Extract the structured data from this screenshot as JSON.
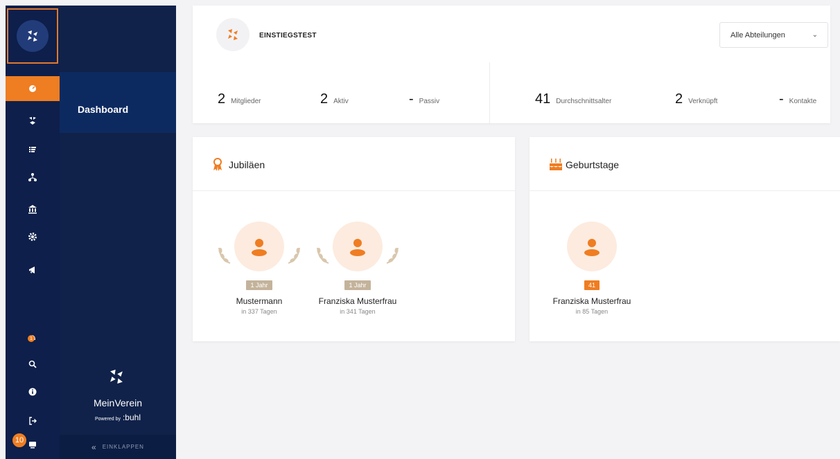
{
  "sidebar": {
    "menu_label": "Dashboard",
    "brand_name": "MeinVerein",
    "powered_by": "Powered by",
    "powered_brand": ":buhl",
    "collapse_label": "EINKLAPPEN",
    "notification_count": "1",
    "bottom_badge": "10"
  },
  "header": {
    "club_name": "EINSTIEGSTEST",
    "department_select": "Alle Abteilungen"
  },
  "stats": [
    {
      "value": "2",
      "label": "Mitglieder"
    },
    {
      "value": "2",
      "label": "Aktiv"
    },
    {
      "value": "-",
      "label": "Passiv"
    },
    {
      "value": "41",
      "label": "Durchschnittsalter"
    },
    {
      "value": "2",
      "label": "Verknüpft"
    },
    {
      "value": "-",
      "label": "Kontakte"
    }
  ],
  "jubilaeen": {
    "title": "Jubiläen",
    "people": [
      {
        "name": "Mustermann",
        "badge": "1 Jahr",
        "sub": "in 337 Tagen"
      },
      {
        "name": "Franziska Musterfrau",
        "badge": "1 Jahr",
        "sub": "in 341 Tagen"
      }
    ]
  },
  "geburtstage": {
    "title": "Geburtstage",
    "people": [
      {
        "name": "Franziska Musterfrau",
        "badge": "41",
        "sub": "in 85 Tagen"
      }
    ]
  },
  "colors": {
    "accent": "#ef7d22",
    "navy": "#0d1f4a",
    "jubilee_badge": "#c4b39b"
  }
}
